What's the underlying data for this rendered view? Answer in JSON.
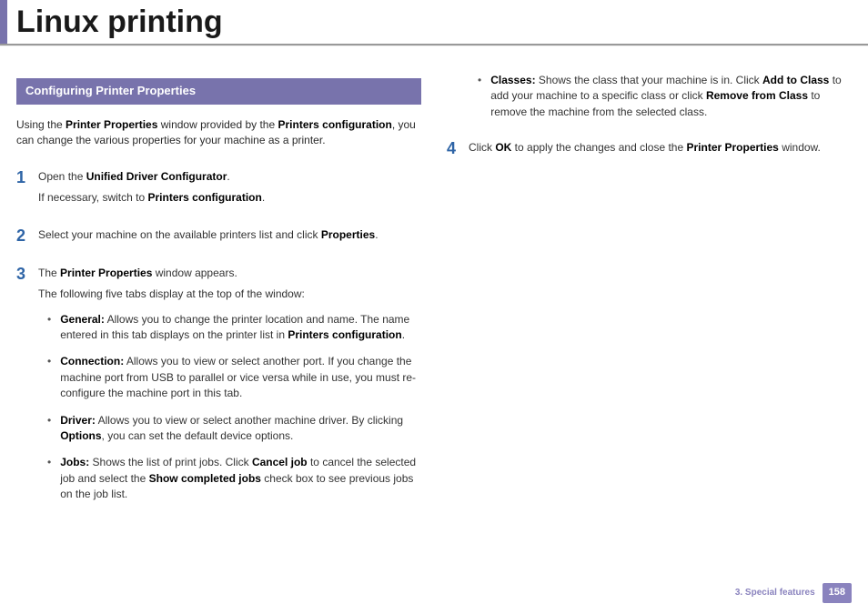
{
  "title": "Linux printing",
  "section_header": "Configuring Printer Properties",
  "intro": {
    "pre": "Using the ",
    "b1": "Printer Properties",
    "mid": " window provided by the ",
    "b2": "Printers configuration",
    "post": ", you can change the various properties for your machine as a printer."
  },
  "steps": {
    "s1": {
      "num": "1",
      "l1a": "Open the ",
      "l1b": "Unified Driver Configurator",
      "l1c": ".",
      "l2a": "If necessary, switch to ",
      "l2b": "Printers configuration",
      "l2c": "."
    },
    "s2": {
      "num": "2",
      "a": "Select your machine on the available printers list and click ",
      "b": "Properties",
      "c": "."
    },
    "s3": {
      "num": "3",
      "l1a": "The ",
      "l1b": "Printer Properties",
      "l1c": " window appears.",
      "l2": "The following five tabs display at the top of the window:",
      "tabs": {
        "general": {
          "title": "General:",
          "a": " Allows you to change the printer location and name. The name entered in this tab displays on the printer list in ",
          "b": "Printers configuration",
          "c": "."
        },
        "connection": {
          "title": "Connection:",
          "a": " Allows you to view or select another port. If you change the machine port from USB to parallel or vice versa while in use, you must re-configure the machine port in this tab."
        },
        "driver": {
          "title": "Driver:",
          "a": " Allows you to view or select another machine driver. By clicking ",
          "b": "Options",
          "c": ", you can set the default device options."
        },
        "jobs": {
          "title": "Jobs:",
          "a": " Shows the list of print jobs. Click ",
          "b": "Cancel job",
          "c": " to cancel the selected job and select the ",
          "d": "Show completed jobs",
          "e": " check box to see previous jobs on the job list."
        },
        "classes": {
          "title": "Classes:",
          "a": " Shows the class that your machine is in. Click ",
          "b": "Add to Class",
          "c": " to add your machine to a specific class or click ",
          "d": "Remove from Class",
          "e": " to remove the machine from the selected class."
        }
      }
    },
    "s4": {
      "num": "4",
      "a": "Click ",
      "b": "OK",
      "c": " to apply the changes and close the ",
      "d": "Printer Properties",
      "e": " window."
    }
  },
  "footer": {
    "chapter": "3.  Special features",
    "page": "158"
  }
}
